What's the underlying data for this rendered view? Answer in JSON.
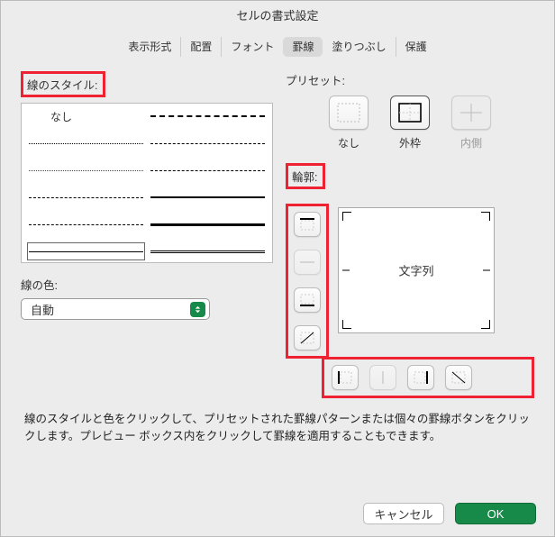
{
  "title": "セルの書式設定",
  "tabs": [
    "表示形式",
    "配置",
    "フォント",
    "罫線",
    "塗りつぶし",
    "保護"
  ],
  "active_tab": 3,
  "left": {
    "style_label": "線のスタイル:",
    "none_label": "なし",
    "color_label": "線の色:",
    "color_value": "自動"
  },
  "right": {
    "preset_label": "プリセット:",
    "presets": {
      "none": "なし",
      "outside": "外枠",
      "inside": "内側"
    },
    "contour_label": "輪郭:",
    "preview_text": "文字列"
  },
  "instructions": "線のスタイルと色をクリックして、プリセットされた罫線パターンまたは個々の罫線ボタンをクリックします。プレビュー ボックス内をクリックして罫線を適用することもできます。",
  "footer": {
    "cancel": "キャンセル",
    "ok": "OK"
  }
}
